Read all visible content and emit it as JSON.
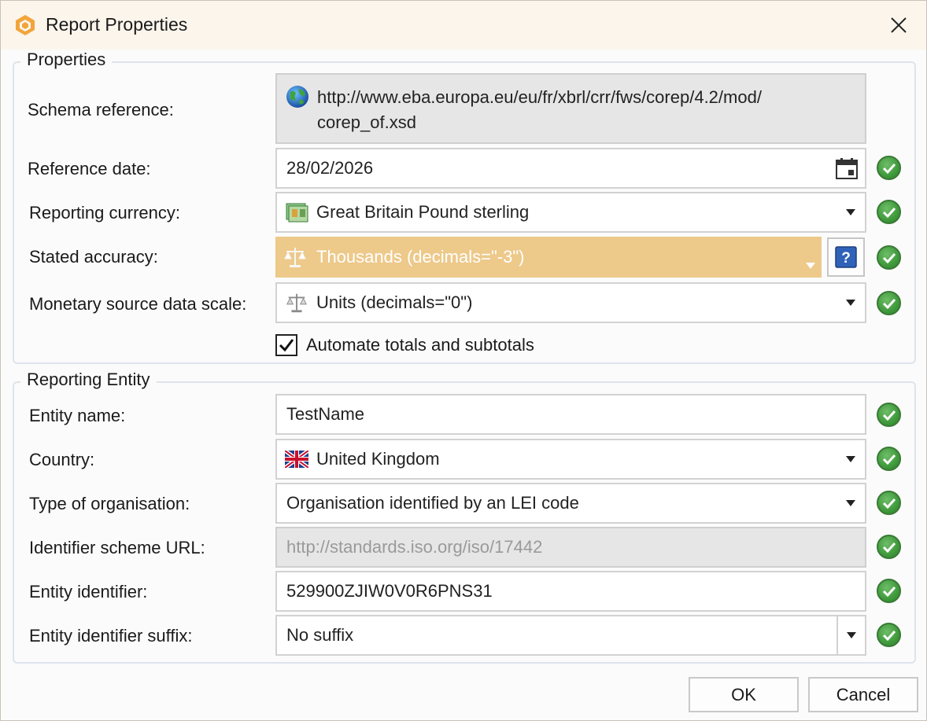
{
  "window": {
    "title": "Report Properties"
  },
  "properties": {
    "legend": "Properties",
    "schema_reference": {
      "label": "Schema reference:",
      "line1": "http://www.eba.europa.eu/eu/fr/xbrl/crr/fws/corep/4.2/mod/",
      "line2": "corep_of.xsd",
      "icon": "globe-icon"
    },
    "reference_date": {
      "label": "Reference date:",
      "value": "28/02/2026",
      "icon": "calendar-icon"
    },
    "reporting_currency": {
      "label": "Reporting currency:",
      "value": "Great Britain Pound sterling",
      "icon": "banknote-icon"
    },
    "stated_accuracy": {
      "label": "Stated accuracy:",
      "value": "Thousands (decimals=\"-3\")",
      "icon": "scale-icon",
      "highlight_color": "#edc98a"
    },
    "monetary_scale": {
      "label": "Monetary source data scale:",
      "value": "Units (decimals=\"0\")",
      "icon": "scale-icon"
    },
    "automate_totals": {
      "label": "Automate totals and subtotals",
      "checked": true
    }
  },
  "reporting_entity": {
    "legend": "Reporting Entity",
    "entity_name": {
      "label": "Entity name:",
      "value": "TestName"
    },
    "country": {
      "label": "Country:",
      "value": "United Kingdom",
      "icon": "uk-flag-icon"
    },
    "organisation_type": {
      "label": "Type of organisation:",
      "value": "Organisation identified by an LEI code"
    },
    "identifier_scheme": {
      "label": "Identifier scheme URL:",
      "value": "http://standards.iso.org/iso/17442"
    },
    "entity_identifier": {
      "label": "Entity identifier:",
      "value": "529900ZJIW0V0R6PNS31"
    },
    "identifier_suffix": {
      "label": "Entity identifier suffix:",
      "value": "No suffix"
    }
  },
  "buttons": {
    "ok": "OK",
    "cancel": "Cancel"
  },
  "colors": {
    "valid_green": "#3f9a3b",
    "accent_orange": "#edc98a",
    "title_bg": "#fbf5ec"
  }
}
